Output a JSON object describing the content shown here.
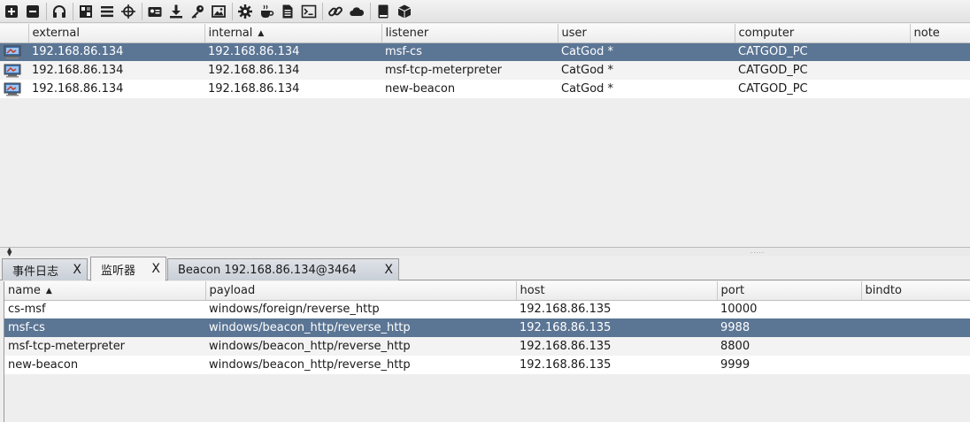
{
  "toolbar": {
    "buttons": [
      {
        "icon": "plus-icon"
      },
      {
        "icon": "minus-icon"
      },
      {
        "sep": true
      },
      {
        "icon": "headphones-icon"
      },
      {
        "sep": true
      },
      {
        "icon": "pivot-graph-icon"
      },
      {
        "icon": "list-icon"
      },
      {
        "icon": "crosshair-icon"
      },
      {
        "sep": true
      },
      {
        "icon": "id-card-icon"
      },
      {
        "icon": "download-icon"
      },
      {
        "icon": "key-icon"
      },
      {
        "icon": "image-icon"
      },
      {
        "sep": true
      },
      {
        "icon": "gear-icon"
      },
      {
        "icon": "coffee-icon"
      },
      {
        "icon": "document-icon"
      },
      {
        "icon": "terminal-icon"
      },
      {
        "sep": true
      },
      {
        "icon": "link-icon"
      },
      {
        "icon": "cloud-icon"
      },
      {
        "sep": true
      },
      {
        "icon": "book-icon"
      },
      {
        "icon": "package-icon"
      }
    ]
  },
  "sessions": {
    "columns": [
      "external",
      "internal",
      "listener",
      "user",
      "computer",
      "note"
    ],
    "sorted_column": "internal",
    "rows": [
      {
        "external": "192.168.86.134",
        "internal": "192.168.86.134",
        "listener": "msf-cs",
        "user": "CatGod *",
        "computer": "CATGOD_PC",
        "note": "",
        "selected": true
      },
      {
        "external": "192.168.86.134",
        "internal": "192.168.86.134",
        "listener": "msf-tcp-meterpreter",
        "user": "CatGod *",
        "computer": "CATGOD_PC",
        "note": "",
        "selected": false
      },
      {
        "external": "192.168.86.134",
        "internal": "192.168.86.134",
        "listener": "new-beacon",
        "user": "CatGod *",
        "computer": "CATGOD_PC",
        "note": "",
        "selected": false
      }
    ]
  },
  "tabs": [
    {
      "label": "事件日志",
      "close": "X",
      "active": false
    },
    {
      "label": "监听器",
      "close": "X",
      "active": true
    },
    {
      "label": "Beacon 192.168.86.134@3464",
      "close": "X",
      "active": false
    }
  ],
  "listeners": {
    "columns": [
      "name",
      "payload",
      "host",
      "port",
      "bindto"
    ],
    "sorted_column": "name",
    "rows": [
      {
        "name": "cs-msf",
        "payload": "windows/foreign/reverse_http",
        "host": "192.168.86.135",
        "port": "10000",
        "bindto": "",
        "selected": false
      },
      {
        "name": "msf-cs",
        "payload": "windows/beacon_http/reverse_http",
        "host": "192.168.86.135",
        "port": "9988",
        "bindto": "",
        "selected": true
      },
      {
        "name": "msf-tcp-meterpreter",
        "payload": "windows/beacon_http/reverse_http",
        "host": "192.168.86.135",
        "port": "8800",
        "bindto": "",
        "selected": false
      },
      {
        "name": "new-beacon",
        "payload": "windows/beacon_http/reverse_http",
        "host": "192.168.86.135",
        "port": "9999",
        "bindto": "",
        "selected": false
      }
    ]
  },
  "colors": {
    "selection": "#5b7594",
    "accent": "#3b6fb0"
  }
}
